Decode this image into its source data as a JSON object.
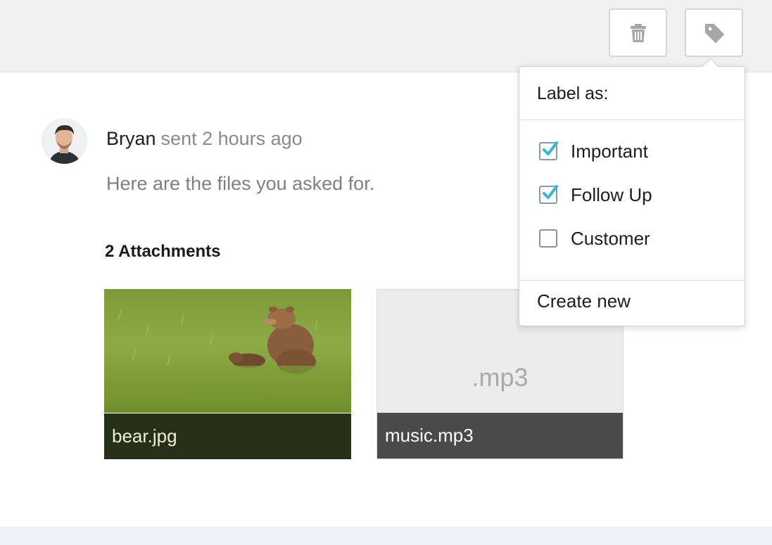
{
  "toolbar": {
    "trash_icon": "trash-icon",
    "tag_icon": "tag-icon"
  },
  "message": {
    "sender": "Bryan",
    "meta": "sent 2 hours ago",
    "body": "Here are the files you asked for.",
    "attachments_title": "2 Attachments"
  },
  "attachments": [
    {
      "name": "bear.jpg",
      "type": "image"
    },
    {
      "name": "music.mp3",
      "type": "audio",
      "extension": ".mp3"
    }
  ],
  "label_menu": {
    "title": "Label as:",
    "options": [
      {
        "label": "Important",
        "checked": true
      },
      {
        "label": "Follow Up",
        "checked": true
      },
      {
        "label": "Customer",
        "checked": false
      }
    ],
    "create_new": "Create new"
  },
  "colors": {
    "check_accent": "#3db3d6",
    "toolbar_bg": "#f0f0f0"
  }
}
